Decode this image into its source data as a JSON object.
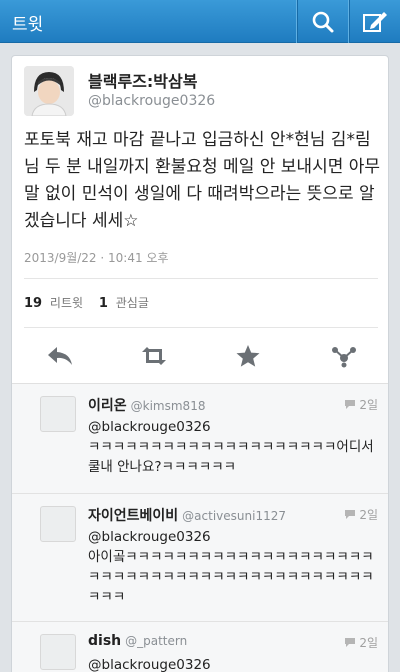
{
  "header": {
    "title": "트윗"
  },
  "tweet": {
    "display_name": "블랙루즈:박삼복",
    "handle": "@blackrouge0326",
    "text": "포토북 재고 마감 끝나고 입금하신 안*현님 김*림님 두 분 내일까지 환불요청 메일 안 보내시면 아무 말 없이 민석이 생일에 다 때려박으라는 뜻으로 알겠습니다 세세☆",
    "timestamp": "2013/9월/22 · 10:41 오후",
    "retweet_count": "19",
    "retweet_label": "리트윗",
    "favorite_count": "1",
    "favorite_label": "관심글"
  },
  "replies": [
    {
      "name": "이리온",
      "handle": "@kimsm818",
      "time": "2일",
      "text_line1": "@blackrouge0326",
      "text_line2": "ㅋㅋㅋㅋㅋㅋㅋㅋㅋㅋㅋㅋㅋㅋㅋㅋㅋㅋㅋㅋ어디서 쿨내 안나요?ㅋㅋㅋㅋㅋㅋ"
    },
    {
      "name": "자이언트베이비",
      "handle": "@activesuni1127",
      "time": "2일",
      "text_line1": "@blackrouge0326",
      "text_line2": "아이곸ㅋㅋㅋㅋㅋㅋㅋㅋㅋㅋㅋㅋㅋㅋㅋㅋㅋㅋㅋㅋㅋㅋㅋㅋㅋㅋㅋㅋㅋㅋㅋㅋㅋㅋㅋㅋㅋㅋㅋㅋㅋㅋㅋㅋㅋㅋ"
    },
    {
      "name": "dish",
      "handle": "@_pattern",
      "time": "2일",
      "text_line1": "@blackrouge0326",
      "text_line2": ""
    }
  ],
  "icons": {
    "search": "search-icon",
    "compose": "compose-icon",
    "reply": "reply-icon",
    "retweet": "retweet-icon",
    "favorite": "star-icon",
    "more": "more-icon",
    "comment": "speech-bubble-icon"
  },
  "colors": {
    "header": "#2a8ccd",
    "text": "#222222",
    "muted": "#8a8f94"
  }
}
